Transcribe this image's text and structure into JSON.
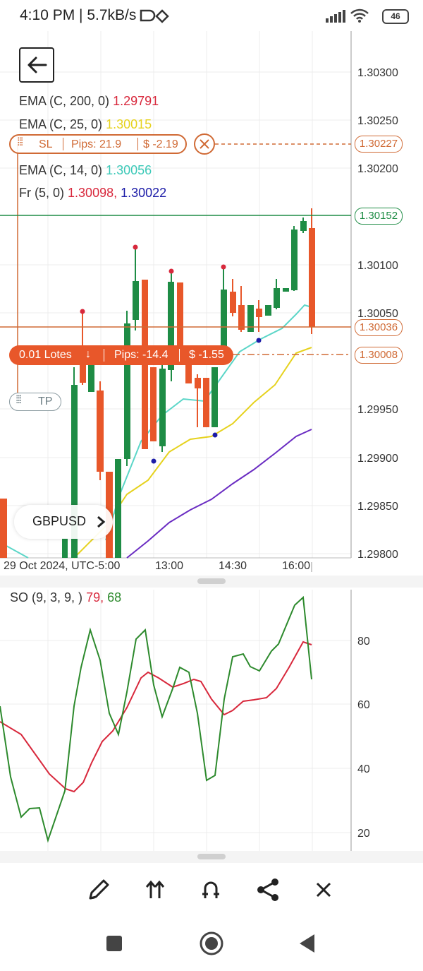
{
  "status_bar": {
    "text": "4:10 PM | 5.7kB/s",
    "battery": "46"
  },
  "chart": {
    "symbol": "GBPUSD",
    "price_axis": [
      "1.30300",
      "1.30250",
      "1.30200",
      "1.30100",
      "1.30050",
      "1.29950",
      "1.29900",
      "1.29850",
      "1.29800"
    ],
    "time_axis": [
      "29 Oct 2024, UTC-5:00",
      "13:00",
      "14:30",
      "16:00"
    ],
    "indicators": {
      "ema200": {
        "label": "EMA (C, 200, 0)",
        "value": "1.29791",
        "color": "#d8283c"
      },
      "ema25": {
        "label": "EMA (C, 25, 0)",
        "value": "1.30015",
        "color": "#e6d21e"
      },
      "ema14": {
        "label": "EMA (C, 14, 0)",
        "value": "1.30056",
        "color": "#5cd6c8"
      },
      "fractals": {
        "label": "Fr (5, 0)",
        "value_up": "1.30098,",
        "value_down": "1.30022",
        "color_up": "#d8283c",
        "color_down": "#1c1ca8"
      }
    },
    "sl_line": {
      "tag": "SL",
      "pips": "Pips: 21.9",
      "profit": "$ -2.19",
      "price": "1.30227"
    },
    "current_price": "1.30152",
    "entry_price": "1.30036",
    "order_line": {
      "lots": "0.01 Lotes",
      "pips": "Pips: -14.4",
      "profit": "$ -1.55",
      "price": "1.30008",
      "partial_price": "1.30008"
    },
    "tp_tag": "TP",
    "colors": {
      "bull": "#1e8c45",
      "bear": "#e8572a",
      "position": "#d06a35",
      "grid": "#ececec"
    }
  },
  "oscillator": {
    "label": "SO (9, 3, 9, )",
    "value_k": "79,",
    "value_d": "68",
    "axis": [
      "80",
      "60",
      "40",
      "20"
    ],
    "color_k": "#d8283c",
    "color_d": "#2d8a2d"
  },
  "toolbar": [
    "pencil-icon",
    "arrows-up-icon",
    "magnet-icon",
    "share-icon",
    "close-icon"
  ],
  "nav": [
    "recents-icon",
    "home-icon",
    "back-icon"
  ]
}
